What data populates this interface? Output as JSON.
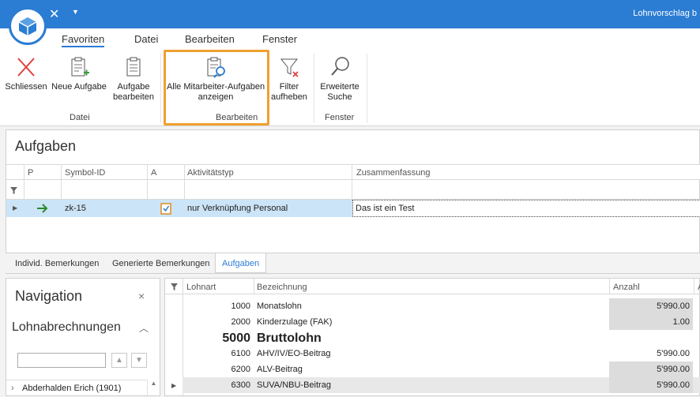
{
  "window": {
    "title": "Lohnvorschlag b"
  },
  "ribbon_tabs": [
    "Favoriten",
    "Datei",
    "Bearbeiten",
    "Fenster"
  ],
  "ribbon": {
    "buttons": {
      "schliessen": "Schliessen",
      "neue_aufgabe": "Neue Aufgabe",
      "aufgabe_bearbeiten_1": "Aufgabe",
      "aufgabe_bearbeiten_2": "bearbeiten",
      "alle_aufgaben_1": "Alle Mitarbeiter-Aufgaben",
      "alle_aufgaben_2": "anzeigen",
      "filter_1": "Filter",
      "filter_2": "aufheben",
      "suche_1": "Erweiterte",
      "suche_2": "Suche"
    },
    "groups": {
      "datei": "Datei",
      "bearbeiten": "Bearbeiten",
      "fenster": "Fenster"
    }
  },
  "aufgaben": {
    "title": "Aufgaben",
    "columns": [
      "P",
      "Symbol-ID",
      "A",
      "Aktivitätstyp",
      "Zusammenfassung"
    ],
    "row": {
      "symbol_id": "zk-15",
      "aktivitaetstyp": "nur Verknüpfung Personal",
      "zusammenfassung": "Das ist ein Test"
    }
  },
  "bottom_tabs": [
    "Individ. Bemerkungen",
    "Generierte Bemerkungen",
    "Aufgaben"
  ],
  "navigation": {
    "title": "Navigation",
    "close": "×",
    "section": "Lohnabrechnungen",
    "item": "Abderhalden Erich (1901)"
  },
  "lohn": {
    "columns": [
      "Lohnart",
      "Bezeichnung",
      "Anzahl",
      "A"
    ],
    "rows": [
      {
        "lohnart": "1000",
        "bezeichnung": "Monatslohn",
        "anzahl": "5'990.00"
      },
      {
        "lohnart": "2000",
        "bezeichnung": "Kinderzulage (FAK)",
        "anzahl": "1.00"
      },
      {
        "lohnart": "5000",
        "bezeichnung": "Bruttolohn",
        "anzahl": ""
      },
      {
        "lohnart": "6100",
        "bezeichnung": "AHV/IV/EO-Beitrag",
        "anzahl": "5'990.00"
      },
      {
        "lohnart": "6200",
        "bezeichnung": "ALV-Beitrag",
        "anzahl": "5'990.00"
      },
      {
        "lohnart": "6300",
        "bezeichnung": "SUVA/NBU-Beitrag",
        "anzahl": "5'990.00"
      }
    ]
  }
}
